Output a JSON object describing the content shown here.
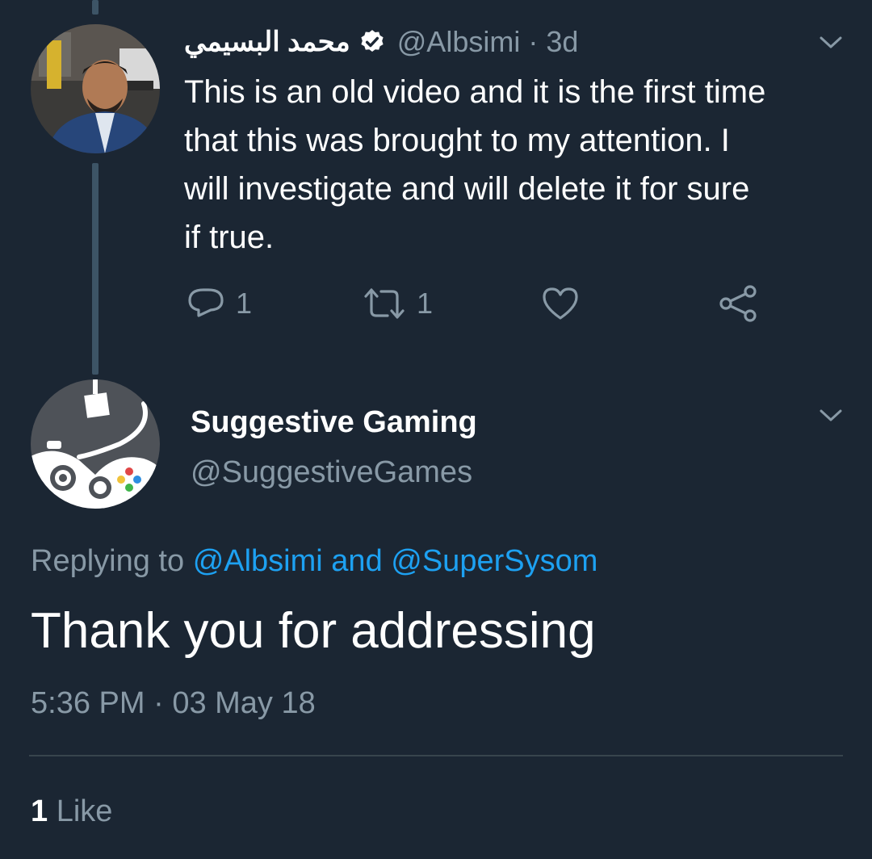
{
  "original_tweet": {
    "display_name": "محمد البسيمي",
    "handle": "@Albsimi",
    "separator": "·",
    "age": "3d",
    "verified_icon": "verified-badge-icon",
    "text_lines": [
      "This is an old video and it is the first time",
      "that this was brought to my attention. I",
      "will investigate and will delete it for sure",
      "if true."
    ],
    "reply_count": "1",
    "retweet_count": "1"
  },
  "reply_tweet": {
    "display_name": "Suggestive Gaming",
    "handle": "@SuggestiveGames",
    "replying_label": "Replying to",
    "replying_handle_1": "@Albsimi",
    "replying_and": "and",
    "replying_handle_2": "@SuperSysom",
    "text": "Thank you for addressing",
    "time": "5:36 PM",
    "separator": "·",
    "date": "03 May 18",
    "like_count": "1",
    "like_label": "Like"
  },
  "colors": {
    "background": "#1b2633",
    "secondary_text": "#8899a6",
    "accent": "#1da1f2",
    "thread_line": "#3d5466"
  }
}
